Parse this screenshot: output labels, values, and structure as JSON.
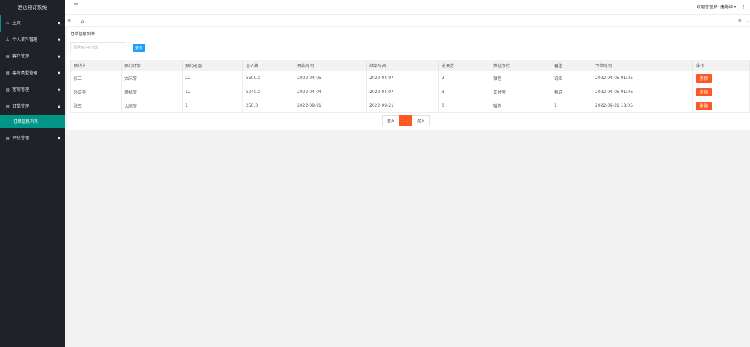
{
  "app": {
    "title": "酒店预订系统"
  },
  "sidebar": {
    "items": [
      {
        "icon": "home-icon",
        "label": "主页"
      },
      {
        "icon": "user-icon",
        "label": "个人资料管理"
      },
      {
        "icon": "list-icon",
        "label": "客户管理"
      },
      {
        "icon": "list-icon",
        "label": "客房类型管理"
      },
      {
        "icon": "list-icon",
        "label": "客房管理"
      },
      {
        "icon": "list-icon",
        "label": "订单管理"
      },
      {
        "icon": "list-icon",
        "label": "评论管理"
      }
    ],
    "sub_active": "订单信息列表"
  },
  "header": {
    "user_text": "欢迎管理员: 唐婕婷 ▾",
    "more": "⋮"
  },
  "tabs": {
    "home_icon": "home-icon"
  },
  "page": {
    "title": "订单信息列表",
    "search_placeholder": "根据用户名查询",
    "search_button": "查询"
  },
  "table": {
    "headers": [
      "预约人",
      "预约订单",
      "预约总额",
      "总价格",
      "开始时间",
      "结束时间",
      "总天数",
      "支付方式",
      "备注",
      "下单时间",
      "操作"
    ],
    "rows": [
      [
        "张三",
        "大床房",
        "22",
        "5500.0",
        "2022-04-05",
        "2022-04-07",
        "2",
        "微信",
        "说法",
        "2022-04-05 01:05",
        "删除"
      ],
      [
        "孙文申",
        "单机房",
        "12",
        "5040.0",
        "2022-04-04",
        "2022-04-07",
        "3",
        "支付宝",
        "我说",
        "2022-04-05 01:06",
        "删除"
      ],
      [
        "张三",
        "大床房",
        "1",
        "250.0",
        "2022-09-21",
        "2022-09-21",
        "0",
        "微信",
        "1",
        "2022-09-21 18:05",
        "删除"
      ]
    ]
  },
  "pagination": {
    "first": "首页",
    "current": "1",
    "last": "尾页"
  },
  "colors": {
    "accent": "#009688",
    "danger": "#ff5722",
    "primary": "#1e9fff",
    "sidebar": "#20222a"
  }
}
